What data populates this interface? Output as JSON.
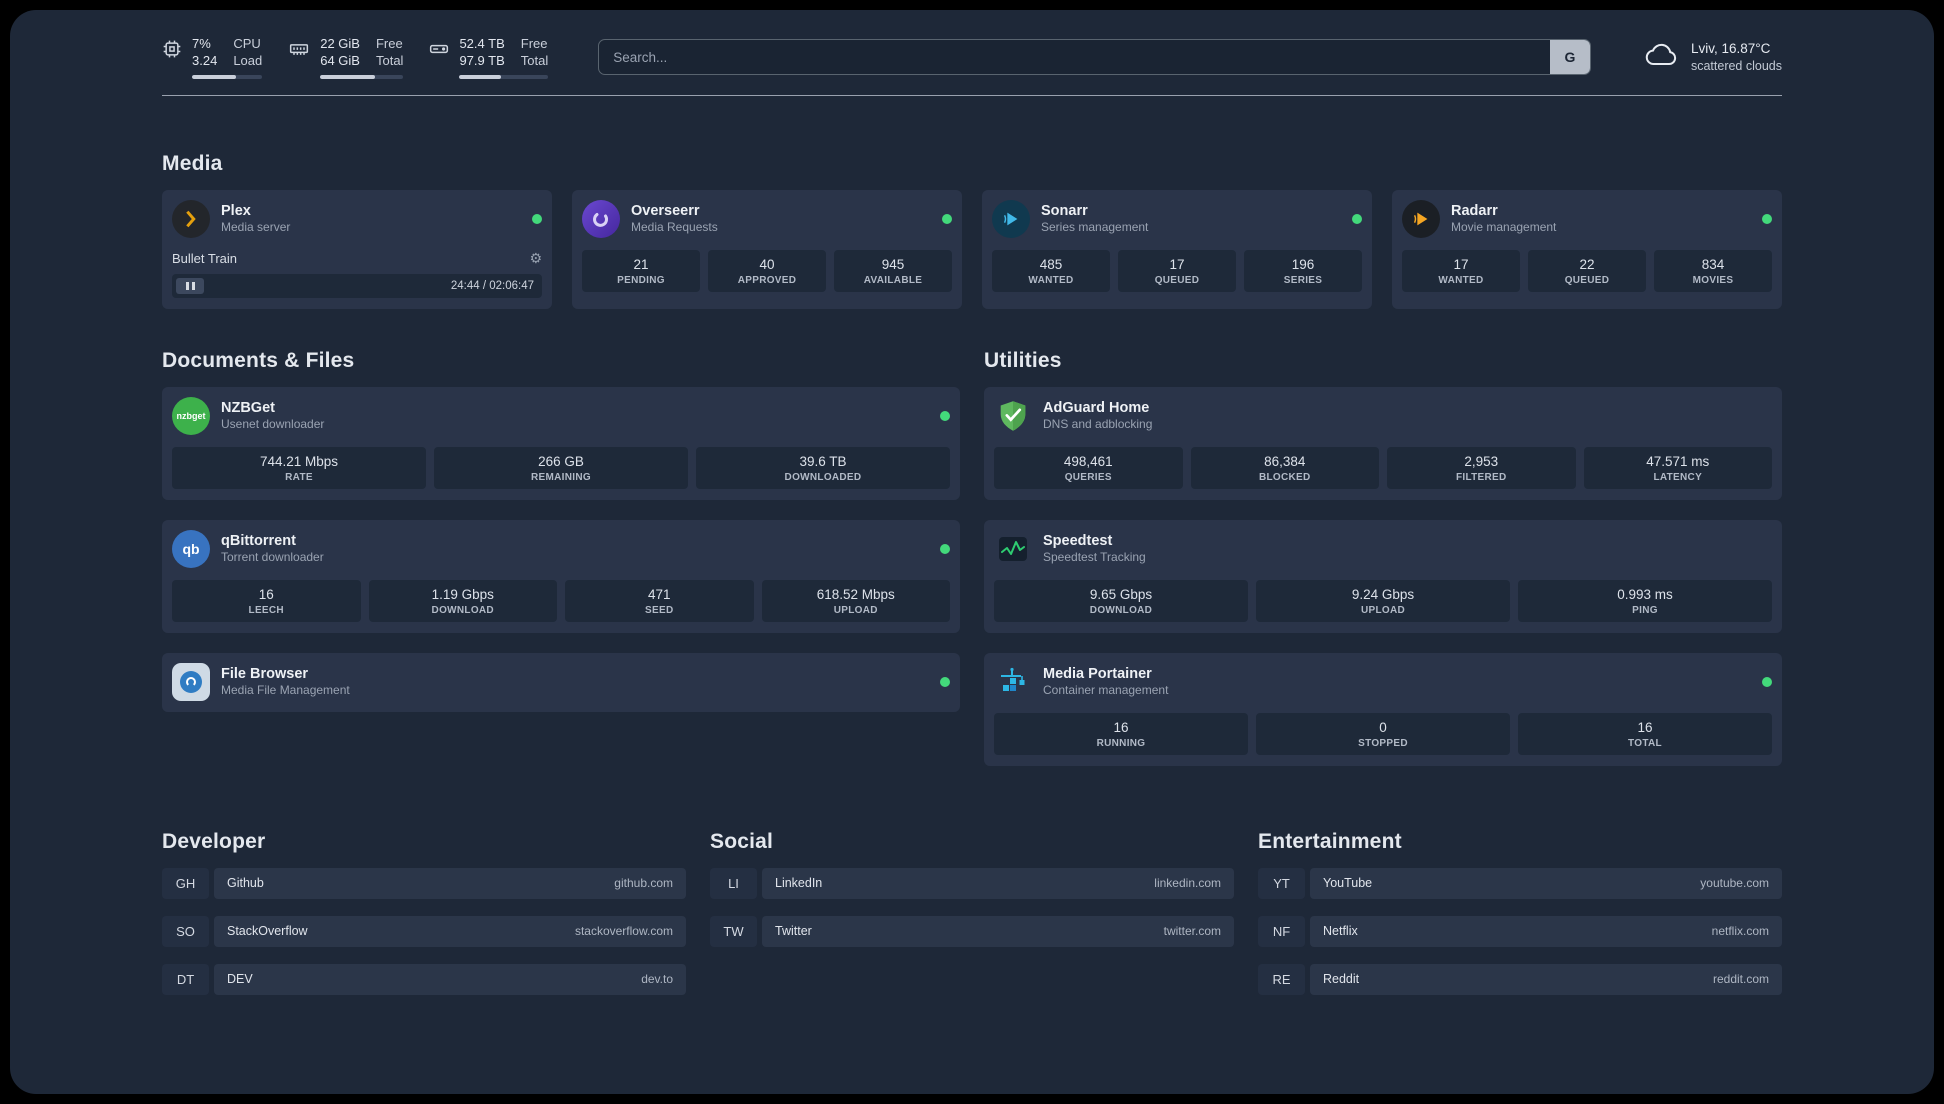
{
  "topbar": {
    "cpu": {
      "v1": "7%",
      "v2": "3.24",
      "l1": "CPU",
      "l2": "Load",
      "bar": "width:62%"
    },
    "memory": {
      "v1": "22 GiB",
      "v2": "64 GiB",
      "l1": "Free",
      "l2": "Total",
      "bar": "width:66%"
    },
    "disk": {
      "v1": "52.4 TB",
      "v2": "97.9 TB",
      "l1": "Free",
      "l2": "Total",
      "bar": "width:47%"
    },
    "search": {
      "placeholder": "Search...",
      "button": "G"
    },
    "weather": {
      "line1": "Lviv, 16.87°C",
      "line2": "scattered clouds"
    }
  },
  "sections": {
    "media": {
      "title": "Media"
    },
    "documents": {
      "title": "Documents & Files"
    },
    "utilities": {
      "title": "Utilities"
    },
    "developer": {
      "title": "Developer"
    },
    "social": {
      "title": "Social"
    },
    "entertainment": {
      "title": "Entertainment"
    }
  },
  "services": {
    "plex": {
      "icon": "plex-icon",
      "name": "Plex",
      "desc": "Media server",
      "status": "online",
      "now_playing": "Bullet Train",
      "time": "24:44 / 02:06:47"
    },
    "overseerr": {
      "icon": "overseerr-icon",
      "name": "Overseerr",
      "desc": "Media Requests",
      "status": "online",
      "stats": [
        {
          "v": "21",
          "l": "PENDING"
        },
        {
          "v": "40",
          "l": "APPROVED"
        },
        {
          "v": "945",
          "l": "AVAILABLE"
        }
      ]
    },
    "sonarr": {
      "icon": "sonarr-icon",
      "name": "Sonarr",
      "desc": "Series management",
      "status": "online",
      "stats": [
        {
          "v": "485",
          "l": "WANTED"
        },
        {
          "v": "17",
          "l": "QUEUED"
        },
        {
          "v": "196",
          "l": "SERIES"
        }
      ]
    },
    "radarr": {
      "icon": "radarr-icon",
      "name": "Radarr",
      "desc": "Movie management",
      "status": "online",
      "stats": [
        {
          "v": "17",
          "l": "WANTED"
        },
        {
          "v": "22",
          "l": "QUEUED"
        },
        {
          "v": "834",
          "l": "MOVIES"
        }
      ]
    },
    "nzbget": {
      "icon": "nzbget-icon",
      "name": "NZBGet",
      "desc": "Usenet downloader",
      "status": "online",
      "stats": [
        {
          "v": "744.21 Mbps",
          "l": "RATE"
        },
        {
          "v": "266 GB",
          "l": "REMAINING"
        },
        {
          "v": "39.6 TB",
          "l": "DOWNLOADED"
        }
      ]
    },
    "qbittorrent": {
      "icon": "qbittorrent-icon",
      "name": "qBittorrent",
      "desc": "Torrent downloader",
      "status": "online",
      "stats": [
        {
          "v": "16",
          "l": "LEECH"
        },
        {
          "v": "1.19 Gbps",
          "l": "DOWNLOAD"
        },
        {
          "v": "471",
          "l": "SEED"
        },
        {
          "v": "618.52 Mbps",
          "l": "UPLOAD"
        }
      ]
    },
    "filebrowser": {
      "icon": "filebrowser-icon",
      "name": "File Browser",
      "desc": "Media File Management",
      "status": "online"
    },
    "adguard": {
      "icon": "adguard-icon",
      "name": "AdGuard Home",
      "desc": "DNS and adblocking",
      "stats": [
        {
          "v": "498,461",
          "l": "QUERIES"
        },
        {
          "v": "86,384",
          "l": "BLOCKED"
        },
        {
          "v": "2,953",
          "l": "FILTERED"
        },
        {
          "v": "47.571 ms",
          "l": "LATENCY"
        }
      ]
    },
    "speedtest": {
      "icon": "speedtest-icon",
      "name": "Speedtest",
      "desc": "Speedtest Tracking",
      "stats": [
        {
          "v": "9.65 Gbps",
          "l": "DOWNLOAD"
        },
        {
          "v": "9.24 Gbps",
          "l": "UPLOAD"
        },
        {
          "v": "0.993 ms",
          "l": "PING"
        }
      ]
    },
    "portainer": {
      "icon": "portainer-icon",
      "name": "Media Portainer",
      "desc": "Container management",
      "status": "online",
      "stats": [
        {
          "v": "16",
          "l": "RUNNING"
        },
        {
          "v": "0",
          "l": "STOPPED"
        },
        {
          "v": "16",
          "l": "TOTAL"
        }
      ]
    }
  },
  "bookmarks": {
    "developer": [
      {
        "abbr": "GH",
        "name": "Github",
        "url": "github.com"
      },
      {
        "abbr": "SO",
        "name": "StackOverflow",
        "url": "stackoverflow.com"
      },
      {
        "abbr": "DT",
        "name": "DEV",
        "url": "dev.to"
      }
    ],
    "social": [
      {
        "abbr": "LI",
        "name": "LinkedIn",
        "url": "linkedin.com"
      },
      {
        "abbr": "TW",
        "name": "Twitter",
        "url": "twitter.com"
      }
    ],
    "entertainment": [
      {
        "abbr": "YT",
        "name": "YouTube",
        "url": "youtube.com"
      },
      {
        "abbr": "NF",
        "name": "Netflix",
        "url": "netflix.com"
      },
      {
        "abbr": "RE",
        "name": "Reddit",
        "url": "reddit.com"
      }
    ]
  },
  "colors": {
    "status_online": "#43d97b",
    "plex_accent": "#e5a00d",
    "overseerr_accent": "#5b3db8",
    "sonarr_accent": "#41b9e8",
    "radarr_accent": "#f5a623",
    "nzbget_accent": "#3db14b",
    "qbittorrent_accent": "#3873c0",
    "adguard_accent": "#5fb85f",
    "speedtest_accent": "#2ecc71",
    "portainer_accent": "#2db7e5"
  }
}
